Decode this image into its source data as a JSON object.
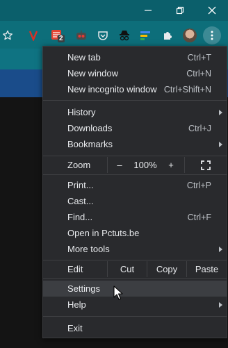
{
  "colors": {
    "titlebar": "#0b5f6b",
    "toolbar": "#0d6e7a",
    "menu_bg": "#292a2d",
    "menu_hover": "#3c3e42"
  },
  "window_controls": [
    "minimize-icon",
    "restore-icon",
    "close-icon"
  ],
  "toolbar": {
    "extensions": [
      "star-icon",
      "vivaldi-v-icon",
      "todoist-icon",
      "robot-icon",
      "pocket-icon",
      "incognito-icon",
      "extension-bars-icon",
      "puzzle-icon",
      "avatar",
      "kebab-menu-icon"
    ],
    "badge": "2"
  },
  "menu": {
    "new_tab": {
      "label": "New tab",
      "shortcut": "Ctrl+T"
    },
    "new_window": {
      "label": "New window",
      "shortcut": "Ctrl+N"
    },
    "new_incognito": {
      "label": "New incognito window",
      "shortcut": "Ctrl+Shift+N"
    },
    "history": {
      "label": "History"
    },
    "downloads": {
      "label": "Downloads",
      "shortcut": "Ctrl+J"
    },
    "bookmarks": {
      "label": "Bookmarks"
    },
    "zoom": {
      "label": "Zoom",
      "minus": "–",
      "value": "100%",
      "plus": "+"
    },
    "print": {
      "label": "Print...",
      "shortcut": "Ctrl+P"
    },
    "cast": {
      "label": "Cast..."
    },
    "find": {
      "label": "Find...",
      "shortcut": "Ctrl+F"
    },
    "open_in": {
      "label": "Open in Pctuts.be"
    },
    "more_tools": {
      "label": "More tools"
    },
    "edit": {
      "label": "Edit",
      "cut": "Cut",
      "copy": "Copy",
      "paste": "Paste"
    },
    "settings": {
      "label": "Settings"
    },
    "help": {
      "label": "Help"
    },
    "exit": {
      "label": "Exit"
    }
  }
}
